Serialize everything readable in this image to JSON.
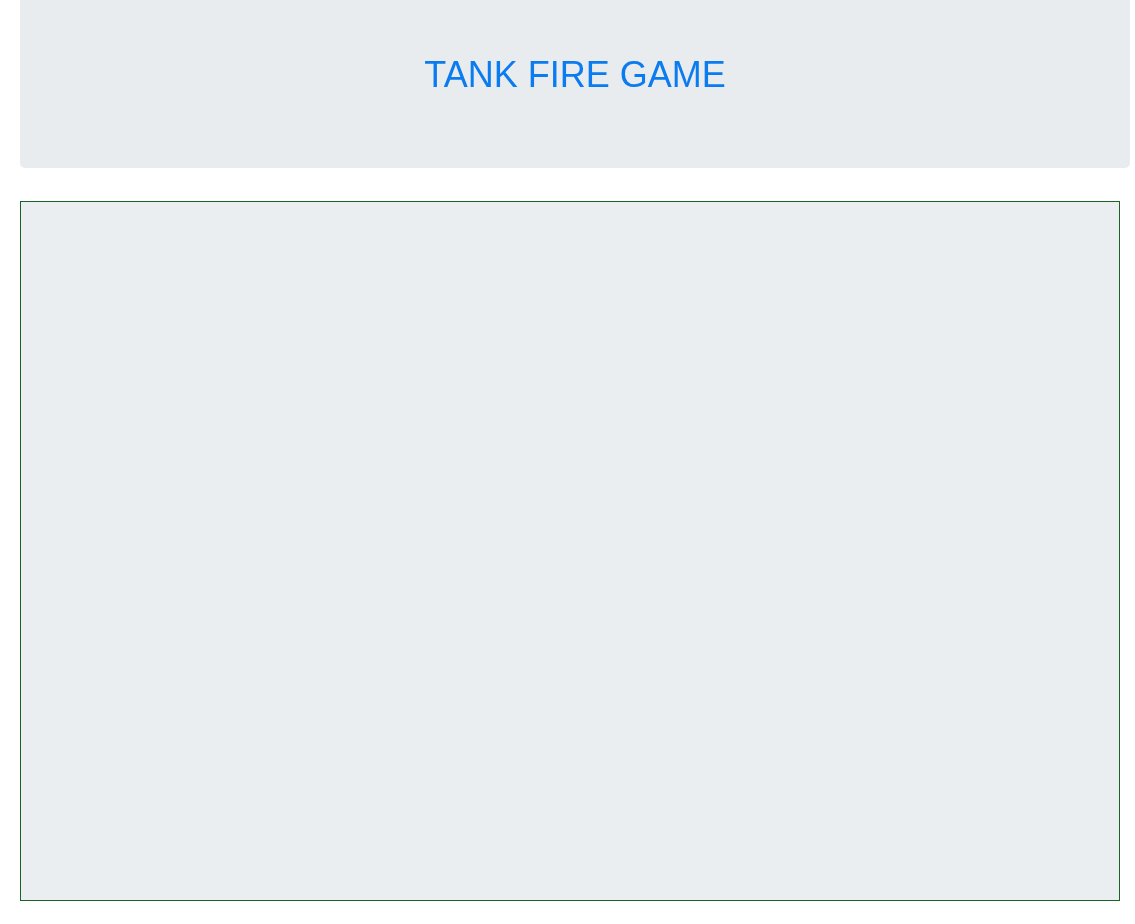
{
  "header": {
    "title": "TANK FIRE GAME"
  }
}
